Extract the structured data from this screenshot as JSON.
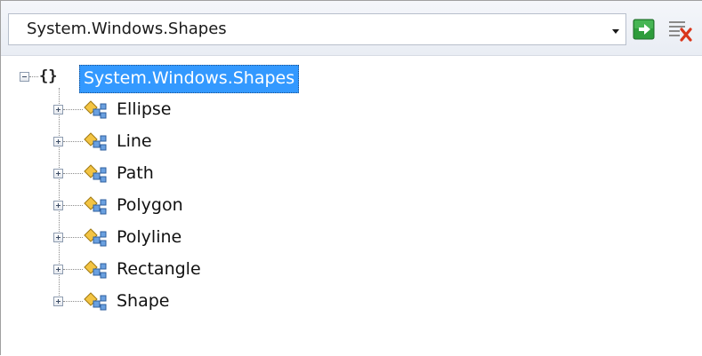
{
  "toolbar": {
    "namespace_value": "System.Windows.Shapes"
  },
  "tree": {
    "root": {
      "label": "System.Windows.Shapes",
      "glyph": "{}"
    },
    "children": [
      {
        "label": "Ellipse"
      },
      {
        "label": "Line"
      },
      {
        "label": "Path"
      },
      {
        "label": "Polygon"
      },
      {
        "label": "Polyline"
      },
      {
        "label": "Rectangle"
      },
      {
        "label": "Shape"
      }
    ]
  },
  "colors": {
    "selection": "#3399ff",
    "go_button": "#2e9c3b",
    "clear_x": "#d9361c"
  }
}
